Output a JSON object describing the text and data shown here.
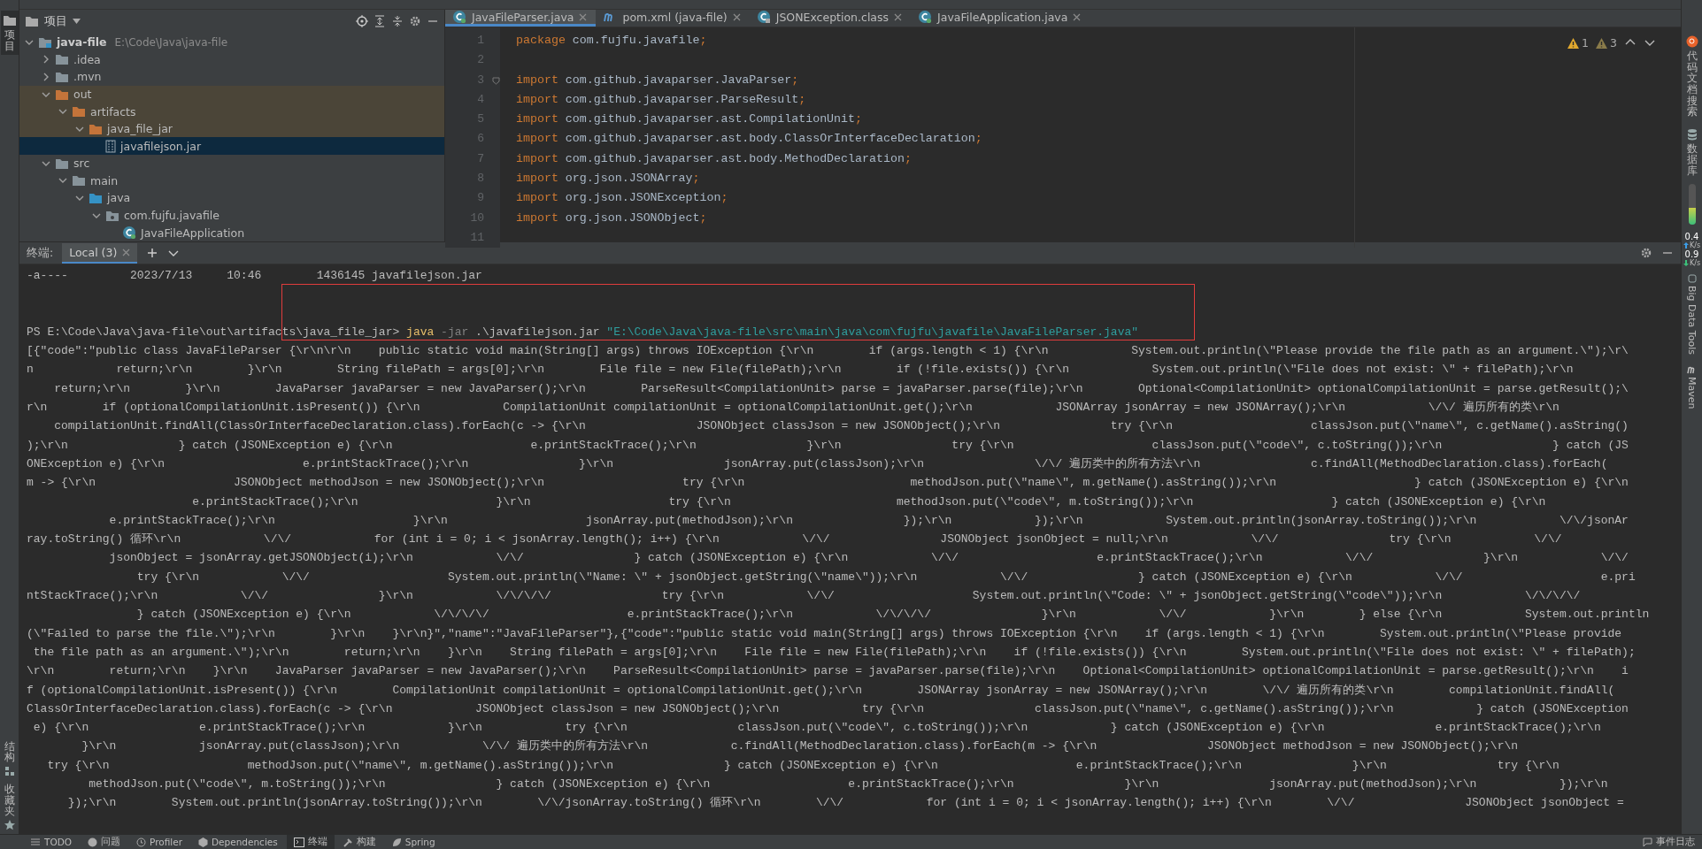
{
  "left_strip": {
    "top_tabs": [
      {
        "label": "项目",
        "selected": true
      }
    ],
    "bottom_tabs": [
      {
        "label": "结构",
        "kind": "structure",
        "selected": false
      },
      {
        "label": "收藏夹",
        "kind": "favorites",
        "selected": false
      }
    ]
  },
  "project_panel": {
    "title": "项目",
    "tree": [
      {
        "name": "java-file",
        "path": "E:\\Code\\Java\\java-file",
        "kind": "module",
        "expanded": true,
        "excluded": false,
        "selected": false,
        "children": [
          {
            "name": ".idea",
            "kind": "folder",
            "expanded": false,
            "excluded": false,
            "selected": false
          },
          {
            "name": ".mvn",
            "kind": "folder",
            "expanded": false,
            "excluded": false,
            "selected": false
          },
          {
            "name": "out",
            "kind": "folder",
            "expanded": true,
            "excluded": true,
            "selected": false,
            "children": [
              {
                "name": "artifacts",
                "kind": "folder",
                "expanded": true,
                "excluded": true,
                "selected": false,
                "children": [
                  {
                    "name": "java_file_jar",
                    "kind": "folder",
                    "expanded": true,
                    "excluded": true,
                    "selected": false,
                    "children": [
                      {
                        "name": "javafilejson.jar",
                        "kind": "jar",
                        "excluded": true,
                        "selected": true
                      }
                    ]
                  }
                ]
              }
            ]
          },
          {
            "name": "src",
            "kind": "folder",
            "expanded": true,
            "excluded": false,
            "selected": false,
            "children": [
              {
                "name": "main",
                "kind": "folder",
                "expanded": true,
                "excluded": false,
                "selected": false,
                "children": [
                  {
                    "name": "java",
                    "kind": "source-root",
                    "expanded": true,
                    "excluded": false,
                    "selected": false,
                    "children": [
                      {
                        "name": "com.fujfu.javafile",
                        "kind": "package",
                        "expanded": true,
                        "excluded": false,
                        "selected": false,
                        "children": [
                          {
                            "name": "JavaFileApplication",
                            "kind": "class",
                            "excluded": false,
                            "selected": false
                          }
                        ]
                      }
                    ]
                  }
                ]
              }
            ]
          }
        ]
      }
    ]
  },
  "editor": {
    "tabs": [
      {
        "label": "JavaFileParser.java",
        "kind": "class",
        "selected": true
      },
      {
        "label": "pom.xml (java-file)",
        "kind": "maven",
        "selected": false
      },
      {
        "label": "JSONException.class",
        "kind": "classfile",
        "selected": false
      },
      {
        "label": "JavaFileApplication.java",
        "kind": "class",
        "selected": false
      }
    ],
    "inspections": [
      {
        "count": "1",
        "kind": "warning"
      },
      {
        "count": "3",
        "kind": "weak"
      }
    ],
    "lines": [
      {
        "number": "1",
        "keyword": "package",
        "body": " com.fujfu.javafile",
        "end": ";"
      },
      {
        "number": "2"
      },
      {
        "number": "3",
        "keyword": "import",
        "body": " com.github.javaparser.JavaParser",
        "end": ";",
        "fold": true
      },
      {
        "number": "4",
        "keyword": "import",
        "body": " com.github.javaparser.ParseResult",
        "end": ";"
      },
      {
        "number": "5",
        "keyword": "import",
        "body": " com.github.javaparser.ast.CompilationUnit",
        "end": ";"
      },
      {
        "number": "6",
        "keyword": "import",
        "body": " com.github.javaparser.ast.body.ClassOrInterfaceDeclaration",
        "end": ";"
      },
      {
        "number": "7",
        "keyword": "import",
        "body": " com.github.javaparser.ast.body.MethodDeclaration",
        "end": ";"
      },
      {
        "number": "8",
        "keyword": "import",
        "body": " org.json.JSONArray",
        "end": ";"
      },
      {
        "number": "9",
        "keyword": "import",
        "body": " org.json.JSONException",
        "end": ";"
      },
      {
        "number": "10",
        "keyword": "import",
        "body": " org.json.JSONObject",
        "end": ";"
      },
      {
        "number": "11"
      }
    ]
  },
  "right_strip": {
    "tools": [
      {
        "label": "代码文档搜索",
        "kind": "doc-search"
      },
      {
        "label": "数据库",
        "kind": "database"
      }
    ],
    "network": {
      "up": "0.4",
      "up_unit": "K/s",
      "down": "0.9",
      "down_unit": "K/s"
    },
    "tools_lower": [
      {
        "label": "Big Data Tools",
        "kind": "bigdata"
      },
      {
        "label": "Maven",
        "kind": "maven"
      }
    ]
  },
  "terminal": {
    "title": "终端:",
    "tabs": [
      {
        "label": "Local (3)",
        "selected": true
      }
    ],
    "lines": [
      {
        "kind": "text",
        "text": "-a----         2023/7/13     10:46        1436145 javafilejson.jar"
      },
      {
        "kind": "blank"
      },
      {
        "kind": "blank"
      },
      {
        "kind": "prompt",
        "parts": [
          {
            "kind": "plain",
            "text": "PS E:\\Code\\Java\\java-file\\out\\artifacts\\java_file_jar> "
          },
          {
            "kind": "command",
            "text": "java"
          },
          {
            "kind": "flag",
            "text": " -jar"
          },
          {
            "kind": "plain",
            "text": " .\\javafilejson.jar "
          },
          {
            "kind": "string",
            "text": "\"E:\\Code\\Java\\java-file\\src\\main\\java\\com\\fujfu\\javafile\\JavaFileParser.java\""
          }
        ]
      },
      {
        "kind": "text",
        "text": "[{\"code\":\"public class JavaFileParser {\\r\\n\\r\\n    public static void main(String[] args) throws IOException {\\r\\n        if (args.length < 1) {\\r\\n            System.out.println(\\\"Please provide the file path as an argument.\\\");\\r\\"
      },
      {
        "kind": "text",
        "text": "n            return;\\r\\n        }\\r\\n        String filePath = args[0];\\r\\n        File file = new File(filePath);\\r\\n        if (!file.exists()) {\\r\\n            System.out.println(\\\"File does not exist: \\\" + filePath);\\r\\n"
      },
      {
        "kind": "text",
        "text": "    return;\\r\\n        }\\r\\n        JavaParser javaParser = new JavaParser();\\r\\n        ParseResult<CompilationUnit> parse = javaParser.parse(file);\\r\\n        Optional<CompilationUnit> optionalCompilationUnit = parse.getResult();\\"
      },
      {
        "kind": "text",
        "text": "r\\n        if (optionalCompilationUnit.isPresent()) {\\r\\n            CompilationUnit compilationUnit = optionalCompilationUnit.get();\\r\\n            JSONArray jsonArray = new JSONArray();\\r\\n            \\/\\/ 遍历所有的类\\r\\n"
      },
      {
        "kind": "text",
        "text": "    compilationUnit.findAll(ClassOrInterfaceDeclaration.class).forEach(c -> {\\r\\n                JSONObject classJson = new JSONObject();\\r\\n                try {\\r\\n                    classJson.put(\\\"name\\\", c.getName().asString()"
      },
      {
        "kind": "text",
        "text": ");\\r\\n                } catch (JSONException e) {\\r\\n                    e.printStackTrace();\\r\\n                }\\r\\n                try {\\r\\n                    classJson.put(\\\"code\\\", c.toString());\\r\\n                } catch (JS"
      },
      {
        "kind": "text",
        "text": "ONException e) {\\r\\n                    e.printStackTrace();\\r\\n                }\\r\\n                jsonArray.put(classJson);\\r\\n                \\/\\/ 遍历类中的所有方法\\r\\n                c.findAll(MethodDeclaration.class).forEach("
      },
      {
        "kind": "text",
        "text": "m -> {\\r\\n                    JSONObject methodJson = new JSONObject();\\r\\n                    try {\\r\\n                        methodJson.put(\\\"name\\\", m.getName().asString());\\r\\n                    } catch (JSONException e) {\\r\\n"
      },
      {
        "kind": "text",
        "text": "                        e.printStackTrace();\\r\\n                    }\\r\\n                    try {\\r\\n                        methodJson.put(\\\"code\\\", m.toString());\\r\\n                    } catch (JSONException e) {\\r\\n"
      },
      {
        "kind": "text",
        "text": "            e.printStackTrace();\\r\\n                    }\\r\\n                    jsonArray.put(methodJson);\\r\\n                });\\r\\n            });\\r\\n            System.out.println(jsonArray.toString());\\r\\n            \\/\\/jsonAr"
      },
      {
        "kind": "text",
        "text": "ray.toString() 循环\\r\\n            \\/\\/            for (int i = 0; i < jsonArray.length(); i++) {\\r\\n            \\/\\/                JSONObject jsonObject = null;\\r\\n            \\/\\/                try {\\r\\n            \\/\\/"
      },
      {
        "kind": "text",
        "text": "            jsonObject = jsonArray.getJSONObject(i);\\r\\n            \\/\\/                } catch (JSONException e) {\\r\\n            \\/\\/                    e.printStackTrace();\\r\\n            \\/\\/                }\\r\\n            \\/\\/"
      },
      {
        "kind": "text",
        "text": "                try {\\r\\n            \\/\\/                    System.out.println(\\\"Name: \\\" + jsonObject.getString(\\\"name\\\"));\\r\\n            \\/\\/                } catch (JSONException e) {\\r\\n            \\/\\/                    e.pri"
      },
      {
        "kind": "text",
        "text": "ntStackTrace();\\r\\n            \\/\\/                }\\r\\n            \\/\\/\\/\\/                try {\\r\\n            \\/\\/                    System.out.println(\\\"Code: \\\" + jsonObject.getString(\\\"code\\\"));\\r\\n            \\/\\/\\/\\/"
      },
      {
        "kind": "text",
        "text": "                } catch (JSONException e) {\\r\\n            \\/\\/\\/\\/                    e.printStackTrace();\\r\\n            \\/\\/\\/\\/                }\\r\\n            \\/\\/            }\\r\\n        } else {\\r\\n            System.out.println"
      },
      {
        "kind": "text",
        "text": "(\\\"Failed to parse the file.\\\");\\r\\n        }\\r\\n    }\\r\\n}\",\"name\":\"JavaFileParser\"},{\"code\":\"public static void main(String[] args) throws IOException {\\r\\n    if (args.length < 1) {\\r\\n        System.out.println(\\\"Please provide"
      },
      {
        "kind": "text",
        "text": " the file path as an argument.\\\");\\r\\n        return;\\r\\n    }\\r\\n    String filePath = args[0];\\r\\n    File file = new File(filePath);\\r\\n    if (!file.exists()) {\\r\\n        System.out.println(\\\"File does not exist: \\\" + filePath);"
      },
      {
        "kind": "text",
        "text": "\\r\\n        return;\\r\\n    }\\r\\n    JavaParser javaParser = new JavaParser();\\r\\n    ParseResult<CompilationUnit> parse = javaParser.parse(file);\\r\\n    Optional<CompilationUnit> optionalCompilationUnit = parse.getResult();\\r\\n    i"
      },
      {
        "kind": "text",
        "text": "f (optionalCompilationUnit.isPresent()) {\\r\\n        CompilationUnit compilationUnit = optionalCompilationUnit.get();\\r\\n        JSONArray jsonArray = new JSONArray();\\r\\n        \\/\\/ 遍历所有的类\\r\\n        compilationUnit.findAll("
      },
      {
        "kind": "text",
        "text": "ClassOrInterfaceDeclaration.class).forEach(c -> {\\r\\n            JSONObject classJson = new JSONObject();\\r\\n            try {\\r\\n                classJson.put(\\\"name\\\", c.getName().asString());\\r\\n            } catch (JSONException"
      },
      {
        "kind": "text",
        "text": " e) {\\r\\n                e.printStackTrace();\\r\\n            }\\r\\n            try {\\r\\n                classJson.put(\\\"code\\\", c.toString());\\r\\n            } catch (JSONException e) {\\r\\n                e.printStackTrace();\\r\\n"
      },
      {
        "kind": "text",
        "text": "        }\\r\\n            jsonArray.put(classJson);\\r\\n            \\/\\/ 遍历类中的所有方法\\r\\n            c.findAll(MethodDeclaration.class).forEach(m -> {\\r\\n                JSONObject methodJson = new JSONObject();\\r\\n"
      },
      {
        "kind": "text",
        "text": "   try {\\r\\n                    methodJson.put(\\\"name\\\", m.getName().asString());\\r\\n                } catch (JSONException e) {\\r\\n                    e.printStackTrace();\\r\\n                }\\r\\n                try {\\r\\n"
      },
      {
        "kind": "text",
        "text": "         methodJson.put(\\\"code\\\", m.toString());\\r\\n                } catch (JSONException e) {\\r\\n                    e.printStackTrace();\\r\\n                }\\r\\n                jsonArray.put(methodJson);\\r\\n            });\\r\\n"
      },
      {
        "kind": "text",
        "text": "      });\\r\\n        System.out.println(jsonArray.toString());\\r\\n        \\/\\/jsonArray.toString() 循环\\r\\n        \\/\\/            for (int i = 0; i < jsonArray.length(); i++) {\\r\\n        \\/\\/                JSONObject jsonObject ="
      }
    ]
  },
  "bottom_bar": {
    "tool_windows": [
      {
        "label": "TODO",
        "kind": "todo",
        "selected": false
      },
      {
        "label": "问题",
        "kind": "problems",
        "selected": false
      },
      {
        "label": "Profiler",
        "kind": "profiler",
        "selected": false
      },
      {
        "label": "Dependencies",
        "kind": "dependencies",
        "selected": false
      },
      {
        "label": "终端",
        "kind": "terminal",
        "selected": true
      },
      {
        "label": "构建",
        "kind": "build",
        "selected": false
      },
      {
        "label": "Spring",
        "kind": "spring",
        "selected": false
      }
    ],
    "right": [
      {
        "label": "事件日志",
        "kind": "events",
        "selected": false
      }
    ]
  }
}
